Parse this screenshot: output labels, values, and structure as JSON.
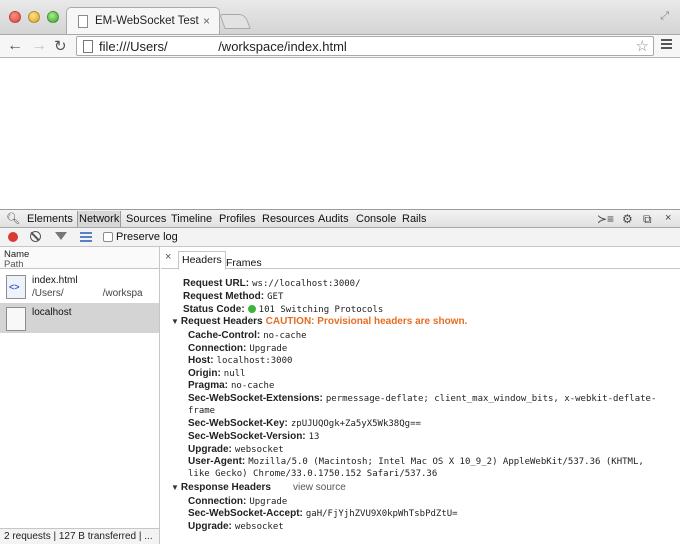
{
  "browser": {
    "tab_title": "EM-WebSocket Test",
    "tab_close": "×",
    "url": "file:///Users/              /workspace/index.html"
  },
  "devtools": {
    "tabs": [
      "Elements",
      "Network",
      "Sources",
      "Timeline",
      "Profiles",
      "Resources",
      "Audits",
      "Console",
      "Rails"
    ],
    "selected_tab": "Network",
    "preserve_log_label": "Preserve log",
    "column_header": {
      "name": "Name",
      "path": "Path"
    },
    "requests": [
      {
        "name": "index.html",
        "path": "/Users/              /workspa"
      },
      {
        "name": "localhost",
        "path": ""
      }
    ],
    "status": "2 requests | 127 B transferred | ...",
    "detail_tabs": {
      "close": "×",
      "headers": "Headers",
      "frames": "Frames"
    },
    "general": {
      "request_url_label": "Request URL:",
      "request_url": "ws://localhost:3000/",
      "request_method_label": "Request Method:",
      "request_method": "GET",
      "status_code_label": "Status Code:",
      "status_code": "101 Switching Protocols"
    },
    "request_headers": {
      "title": "Request Headers",
      "caution": "CAUTION: Provisional headers are shown.",
      "items": [
        {
          "key": "Cache-Control:",
          "value": "no-cache"
        },
        {
          "key": "Connection:",
          "value": "Upgrade"
        },
        {
          "key": "Host:",
          "value": "localhost:3000"
        },
        {
          "key": "Origin:",
          "value": "null"
        },
        {
          "key": "Pragma:",
          "value": "no-cache"
        },
        {
          "key": "Sec-WebSocket-Extensions:",
          "value": "permessage-deflate; client_max_window_bits, x-webkit-deflate-frame"
        },
        {
          "key": "Sec-WebSocket-Key:",
          "value": "zpUJUQOgk+Za5yX5Wk38Qg=="
        },
        {
          "key": "Sec-WebSocket-Version:",
          "value": "13"
        },
        {
          "key": "Upgrade:",
          "value": "websocket"
        },
        {
          "key": "User-Agent:",
          "value": "Mozilla/5.0 (Macintosh; Intel Mac OS X 10_9_2) AppleWebKit/537.36 (KHTML, like Gecko) Chrome/33.0.1750.152 Safari/537.36"
        }
      ]
    },
    "response_headers": {
      "title": "Response Headers",
      "view_source": "view source",
      "items": [
        {
          "key": "Connection:",
          "value": "Upgrade"
        },
        {
          "key": "Sec-WebSocket-Accept:",
          "value": "gaH/FjYjhZVU9X0kpWhTsbPdZtU="
        },
        {
          "key": "Upgrade:",
          "value": "websocket"
        }
      ]
    },
    "colors": {
      "caution": "#e66d22",
      "status_ok": "#3bb43b",
      "record": "#d93a33"
    }
  }
}
